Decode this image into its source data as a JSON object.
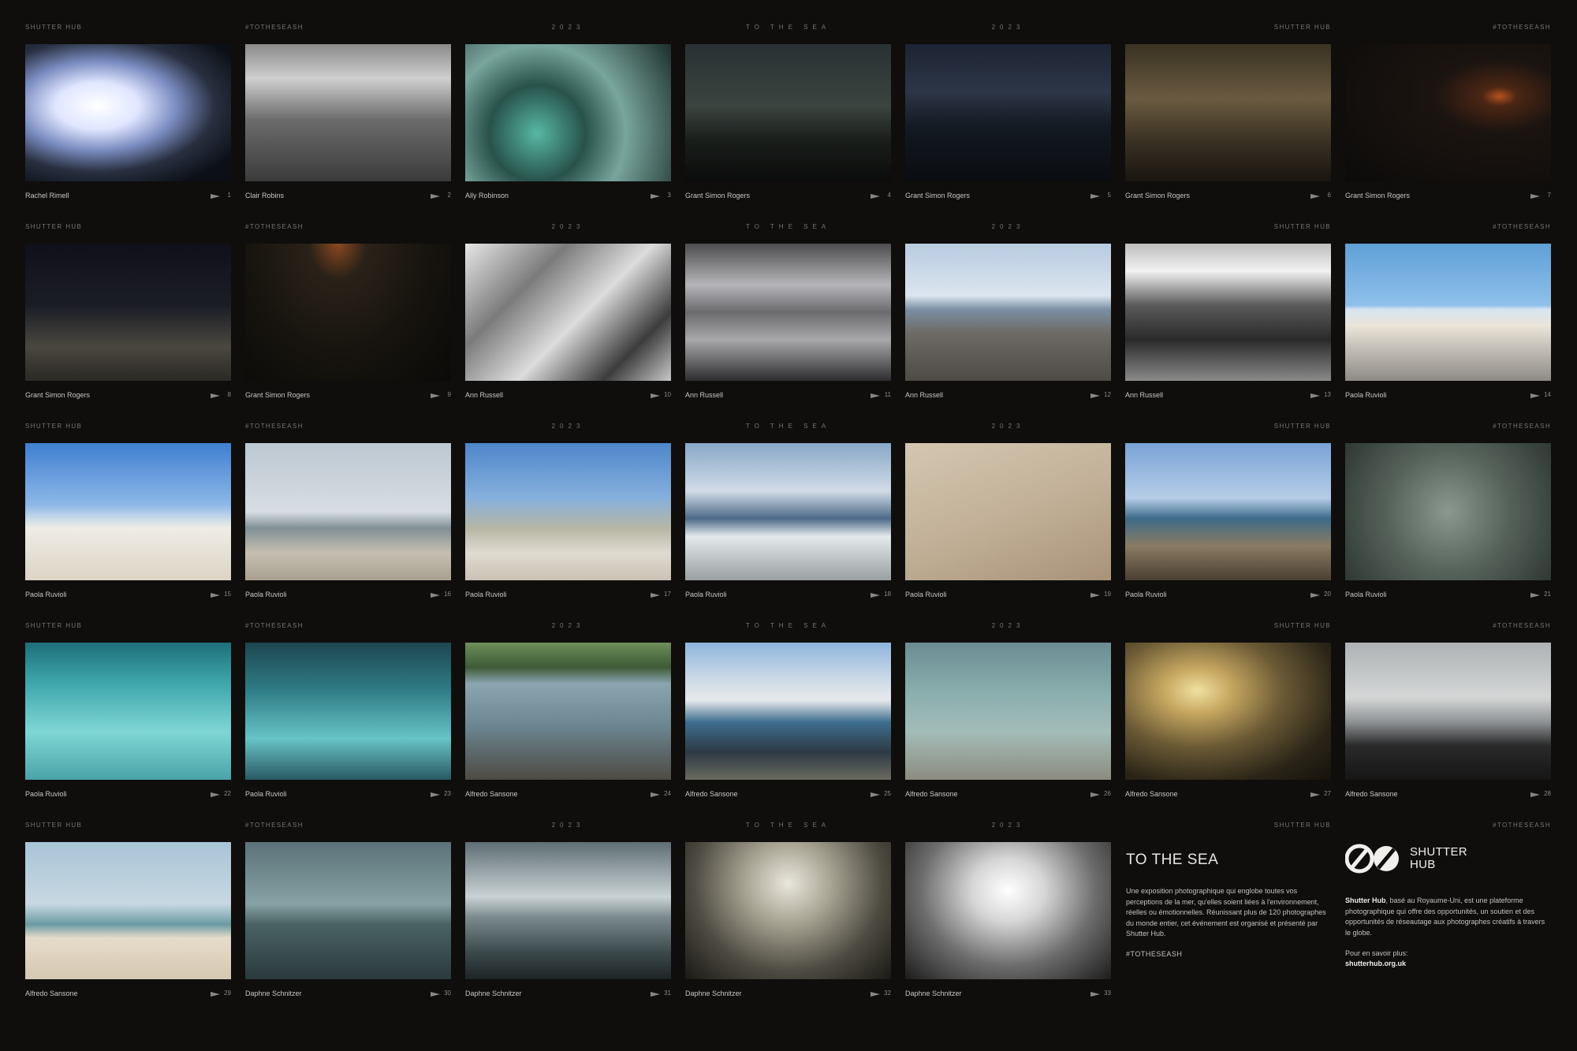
{
  "labels": {
    "shutter_hub": "SHUTTER HUB",
    "hashtag": "#TOTHESEASH",
    "year": "2023",
    "to_the_sea": "TO THE SEA"
  },
  "photos": [
    {
      "name": "Rachel Rimell",
      "num": "1",
      "bg": "radial-gradient(ellipse at 35% 45%, #ffffff 0%, #dfe6ff 22%, #7a8bc0 42%, #283040 62%, #0c0f16 85%)"
    },
    {
      "name": "Clair Robins",
      "num": "2",
      "bg": "linear-gradient(180deg, #8a8a8a 0%, #cfcfcf 25%, #6c6c6c 55%, #3b3b3b 100%)"
    },
    {
      "name": "Ally Robinson",
      "num": "3",
      "bg": "radial-gradient(circle at 35% 65%, #57b8a4 0%, #28524a 30%, #78a59c 55%, #1c2e2b 100%)"
    },
    {
      "name": "Grant Simon Rogers",
      "num": "4",
      "bg": "linear-gradient(180deg, #2a3134 0%, #3c4440 45%, #1a1e1b 70%, #0b0c0b 100%)"
    },
    {
      "name": "Grant Simon Rogers",
      "num": "5",
      "bg": "linear-gradient(180deg, #1c2433 0%, #2d3647 35%, #141a22 60%, #0a0c10 100%)"
    },
    {
      "name": "Grant Simon Rogers",
      "num": "6",
      "bg": "linear-gradient(180deg, #3a3224 0%, #6a5a40 40%, #3b3224 70%, #191510 100%)"
    },
    {
      "name": "Grant Simon Rogers",
      "num": "7",
      "bg": "radial-gradient(ellipse at 75% 38%, #b5521e 0%, #4b2614 8%, #1b1410 30%, #0c0b0a 100%)"
    },
    {
      "name": "Grant Simon Rogers",
      "num": "8",
      "bg": "linear-gradient(180deg, #10101a 0%, #1b1d25 45%, #4a4740 75%, #2b2925 100%)"
    },
    {
      "name": "Grant Simon Rogers",
      "num": "9",
      "bg": "radial-gradient(ellipse at 45% 0%, #8a4820 0%, #2a2218 18%, #17140f 55%, #0b0a08 100%)"
    },
    {
      "name": "Ann Russell",
      "num": "10",
      "bg": "linear-gradient(135deg, #e6e6e6 0%, #7b7b7b 30%, #dcdcdc 55%, #3c3c3c 80%, #c8c8c8 100%)"
    },
    {
      "name": "Ann Russell",
      "num": "11",
      "bg": "linear-gradient(180deg, #4d4d4f 0%, #b5b5b9 30%, #6b6b6e 50%, #a8a8ab 70%, #2d2d2f 100%)"
    },
    {
      "name": "Ann Russell",
      "num": "12",
      "bg": "linear-gradient(180deg, #b8cbe0 0%, #dbe5ef 38%, #7a8fa3 48%, #6e6b66 65%, #4e4b47 100%)"
    },
    {
      "name": "Ann Russell",
      "num": "13",
      "bg": "linear-gradient(180deg, #bdbdbd 0%, #f2f2f2 20%, #5a5a5a 45%, #2a2a2a 70%, #8a8a8a 100%)"
    },
    {
      "name": "Paola Ruvioli",
      "num": "14",
      "bg": "linear-gradient(180deg, #5fa0d7 0%, #8fc0ea 45%, #d7e5f0 48%, #eae4d8 60%, #8d8a86 100%)"
    },
    {
      "name": "Paola Ruvioli",
      "num": "15",
      "bg": "linear-gradient(180deg, #3f7fd1 0%, #8db8e8 45%, #c8dbe8 55%, #efece6 62%, #dcd4c4 100%)"
    },
    {
      "name": "Paola Ruvioli",
      "num": "16",
      "bg": "linear-gradient(180deg, #bcc8d2 0%, #d7dde2 50%, #7f8f95 62%, #c6bfb1 80%, #a9a090 100%)"
    },
    {
      "name": "Paola Ruvioli",
      "num": "17",
      "bg": "linear-gradient(180deg, #4d86c9 0%, #86b0dd 40%, #b6b6a4 62%, #e0dbd0 80%, #c9c2b4 100%)"
    },
    {
      "name": "Paola Ruvioli",
      "num": "18",
      "bg": "linear-gradient(180deg, #89a8c8 0%, #d0dbe6 35%, #4c6a88 55%, #e4e9ec 68%, #9aa0a1 100%)"
    },
    {
      "name": "Paola Ruvioli",
      "num": "19",
      "bg": "linear-gradient(160deg, #d4c6b0 0%, #c2b198 50%, #a89379 100%)"
    },
    {
      "name": "Paola Ruvioli",
      "num": "20",
      "bg": "linear-gradient(180deg, #7aa3d6 0%, #b5cde6 40%, #3e6b89 55%, #8a7b63 75%, #4a3f33 100%)"
    },
    {
      "name": "Paola Ruvioli",
      "num": "21",
      "bg": "radial-gradient(circle at 50% 50%, #8a9890 0%, #55625a 50%, #2f3833 100%)"
    },
    {
      "name": "Paola Ruvioli",
      "num": "22",
      "bg": "linear-gradient(180deg, #1e6f7a 0%, #3fa7ad 30%, #7fd6d4 65%, #4aa3a8 100%)"
    },
    {
      "name": "Paola Ruvioli",
      "num": "23",
      "bg": "linear-gradient(180deg, #1d4650 0%, #2f7d86 35%, #67c3c6 70%, #2a5a63 100%)"
    },
    {
      "name": "Alfredo Sansone",
      "num": "24",
      "bg": "linear-gradient(180deg, #6e8f5a 0%, #3e5a36 18%, #8aa5b0 30%, #6c8792 60%, #4e4a44 100%)"
    },
    {
      "name": "Alfredo Sansone",
      "num": "25",
      "bg": "linear-gradient(180deg, #8fb5de 0%, #c8d8e6 25%, #e7e9eb 42%, #3e6e8e 58%, #2e3a44 80%, #6a6a60 100%)"
    },
    {
      "name": "Alfredo Sansone",
      "num": "26",
      "bg": "linear-gradient(180deg, #6b8d92 0%, #8db0b0 40%, #a3bcb7 65%, #8c8c80 100%)"
    },
    {
      "name": "Alfredo Sansone",
      "num": "27",
      "bg": "radial-gradient(ellipse at 35% 35%, #f0e0a0 0%, #c6a760 18%, #6b5a35 45%, #2b2518 75%, #15120c 100%)"
    },
    {
      "name": "Alfredo Sansone",
      "num": "28",
      "bg": "linear-gradient(180deg, #aeb2b4 0%, #d4d6d6 40%, #8e9294 58%, #2a2a2a 75%, #161616 100%)"
    },
    {
      "name": "Alfredo Sansone",
      "num": "29",
      "bg": "linear-gradient(180deg, #a9c4d6 0%, #c8d8e2 45%, #6a9aa2 60%, #e6dccb 70%, #d6c8b2 100%)"
    },
    {
      "name": "Daphne Schnitzer",
      "num": "30",
      "bg": "linear-gradient(180deg, #5b7278 0%, #87a2a4 45%, #4a6264 60%, #2b3a3c 100%)"
    },
    {
      "name": "Daphne Schnitzer",
      "num": "31",
      "bg": "linear-gradient(180deg, #5e6e74 0%, #c9d2d4 40%, #7a8a8c 55%, #3c4a4c 80%, #1e2426 100%)"
    },
    {
      "name": "Daphne Schnitzer",
      "num": "32",
      "bg": "radial-gradient(ellipse at 50% 30%, #e9e6dc 0%, #a7a392 30%, #4e4b42 65%, #1a1915 100%)"
    },
    {
      "name": "Daphne Schnitzer",
      "num": "33",
      "bg": "radial-gradient(ellipse at 50% 35%, #ffffff 0%, #d6d6d6 25%, #6d6d6d 60%, #1c1c1c 100%)"
    }
  ],
  "info": {
    "title": "TO THE SEA",
    "description": "Une exposition photographique qui englobe toutes vos perceptions de la mer, qu'elles soient liées à l'environnement, réelles ou émotionnelles. Réunissant plus de 120 photographes du monde entier, cet événement est organisé et présenté par Shutter Hub.",
    "hashtag": "#TOTHESEASH"
  },
  "brand": {
    "logo_line1": "SHUTTER",
    "logo_line2": "HUB",
    "about_bold": "Shutter Hub",
    "about_rest": ", basé au Royaume-Uni, est une plateforme photographique qui offre des opportunités, un soutien et des opportunités de réseautage aux photographes créatifs à travers le globe.",
    "more_label": "Pour en savoir plus:",
    "website": "shutterhub.org.uk"
  },
  "colors": {
    "background": "#0f0e0d",
    "text": "#c9c6c0",
    "muted": "#77746f",
    "accent_red": "#b41e1e"
  }
}
